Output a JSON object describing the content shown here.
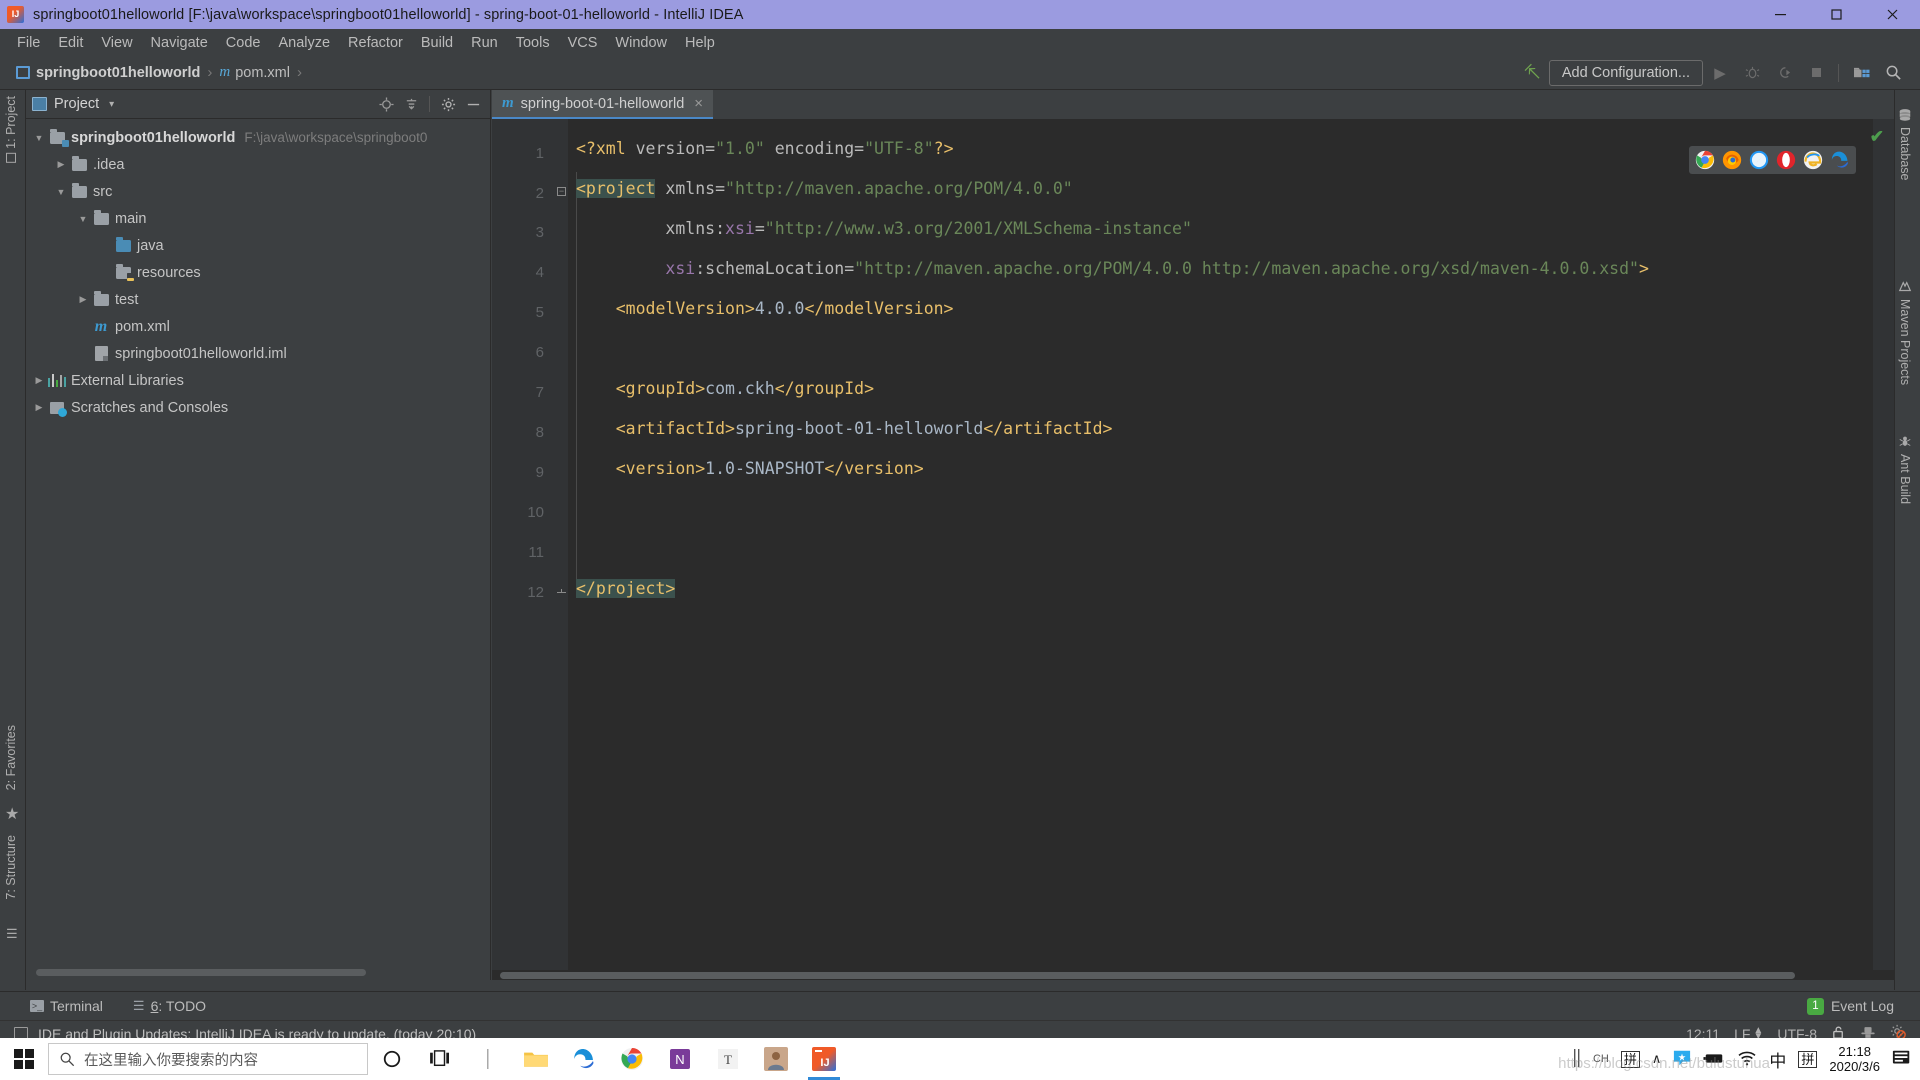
{
  "window": {
    "title": "springboot01helloworld [F:\\java\\workspace\\springboot01helloworld] - spring-boot-01-helloworld - IntelliJ IDEA",
    "app_icon": "intellij-idea-icon",
    "minimize_label": "—",
    "maximize_label": "❐",
    "close_label": "✕",
    "titlebar_color": "#9b9be0"
  },
  "menubar": {
    "items": [
      {
        "label": "File"
      },
      {
        "label": "Edit"
      },
      {
        "label": "View"
      },
      {
        "label": "Navigate"
      },
      {
        "label": "Code"
      },
      {
        "label": "Analyze"
      },
      {
        "label": "Refactor"
      },
      {
        "label": "Build"
      },
      {
        "label": "Run"
      },
      {
        "label": "Tools"
      },
      {
        "label": "VCS"
      },
      {
        "label": "Window"
      },
      {
        "label": "Help"
      }
    ]
  },
  "navbar": {
    "breadcrumb": {
      "project": "springboot01helloworld",
      "separator": "›",
      "file_icon": "m",
      "file": "pom.xml"
    },
    "add_configuration": "Add Configuration...",
    "icons": [
      "run-icon",
      "debug-icon",
      "run-with-coverage-icon",
      "stop-icon",
      "project-structure-icon",
      "search-everywhere-icon"
    ]
  },
  "left_rail": {
    "top": "1: Project",
    "favorites": "2: Favorites",
    "structure": "7: Structure"
  },
  "right_rail": {
    "database": "Database",
    "maven": "Maven Projects",
    "ant": "Ant Build"
  },
  "project_panel": {
    "title": "Project",
    "caret": "▾",
    "actions": [
      "locate-icon",
      "collapse-all-icon",
      "settings-gear-icon",
      "hide-icon"
    ],
    "tree": [
      {
        "label": "springboot01helloworld",
        "path": "F:\\java\\workspace\\springboot0",
        "depth": 0,
        "twisty": "▼",
        "icon": "module-folder-icon",
        "bold": true
      },
      {
        "label": ".idea",
        "path": "",
        "depth": 1,
        "twisty": "▶",
        "icon": "folder-icon",
        "bold": false
      },
      {
        "label": "src",
        "path": "",
        "depth": 1,
        "twisty": "▼",
        "icon": "folder-icon",
        "bold": false
      },
      {
        "label": "main",
        "path": "",
        "depth": 2,
        "twisty": "▼",
        "icon": "folder-icon",
        "bold": false
      },
      {
        "label": "java",
        "path": "",
        "depth": 3,
        "twisty": "",
        "icon": "source-folder-icon",
        "bold": false
      },
      {
        "label": "resources",
        "path": "",
        "depth": 3,
        "twisty": "",
        "icon": "resources-folder-icon",
        "bold": false
      },
      {
        "label": "test",
        "path": "",
        "depth": 2,
        "twisty": "▶",
        "icon": "folder-icon",
        "bold": false
      },
      {
        "label": "pom.xml",
        "path": "",
        "depth": 2,
        "twisty": "",
        "icon": "maven-file-icon",
        "bold": false
      },
      {
        "label": "springboot01helloworld.iml",
        "path": "",
        "depth": 2,
        "twisty": "",
        "icon": "iml-file-icon",
        "bold": false
      },
      {
        "label": "External Libraries",
        "path": "",
        "depth": 0,
        "twisty": "▶",
        "icon": "libraries-icon",
        "bold": false
      },
      {
        "label": "Scratches and Consoles",
        "path": "",
        "depth": 0,
        "twisty": "▶",
        "icon": "scratches-icon",
        "bold": false
      }
    ]
  },
  "editor": {
    "tab": {
      "label": "spring-boot-01-helloworld",
      "icon": "m",
      "close": "×"
    },
    "inspection_status": "✔",
    "browsers": [
      {
        "name": "chrome-icon",
        "color": "#4285f4"
      },
      {
        "name": "firefox-icon",
        "color": "#e66000"
      },
      {
        "name": "safari-icon",
        "color": "#2196f3"
      },
      {
        "name": "opera-icon",
        "color": "#e0252b"
      },
      {
        "name": "internet-explorer-icon",
        "color": "#f0b323"
      },
      {
        "name": "edge-icon",
        "color": "#1a8fd8"
      }
    ],
    "line_numbers": [
      1,
      2,
      3,
      4,
      5,
      6,
      7,
      8,
      9,
      10,
      11,
      12
    ],
    "code_lines": [
      {
        "n": 1,
        "segments": [
          {
            "t": "<?xml ",
            "c": "tag"
          },
          {
            "t": "version=",
            "c": "attr"
          },
          {
            "t": "\"1.0\"",
            "c": "str"
          },
          {
            "t": " encoding=",
            "c": "attr"
          },
          {
            "t": "\"UTF-8\"",
            "c": "str"
          },
          {
            "t": "?>",
            "c": "tag"
          }
        ]
      },
      {
        "n": 2,
        "segments": [
          {
            "t": "<project",
            "c": "tag hl"
          },
          {
            "t": " xmlns=",
            "c": "attr"
          },
          {
            "t": "\"http://maven.apache.org/POM/4.0.0\"",
            "c": "str"
          }
        ]
      },
      {
        "n": 3,
        "segments": [
          {
            "t": "         xmlns:",
            "c": "attr"
          },
          {
            "t": "xsi",
            "c": "ns"
          },
          {
            "t": "=",
            "c": "attr"
          },
          {
            "t": "\"http://www.w3.org/2001/XMLSchema-instance\"",
            "c": "str"
          }
        ]
      },
      {
        "n": 4,
        "segments": [
          {
            "t": "         ",
            "c": "attr"
          },
          {
            "t": "xsi",
            "c": "ns"
          },
          {
            "t": ":schemaLocation=",
            "c": "attr"
          },
          {
            "t": "\"http://maven.apache.org/POM/4.0.0 http://maven.apache.org/xsd/maven-4.0.0.xsd\"",
            "c": "str"
          },
          {
            "t": ">",
            "c": "tag"
          }
        ]
      },
      {
        "n": 5,
        "segments": [
          {
            "t": "    <modelVersion>",
            "c": "tag"
          },
          {
            "t": "4.0.0",
            "c": "txt"
          },
          {
            "t": "</modelVersion>",
            "c": "tag"
          }
        ]
      },
      {
        "n": 6,
        "segments": []
      },
      {
        "n": 7,
        "segments": [
          {
            "t": "    <groupId>",
            "c": "tag"
          },
          {
            "t": "com.ckh",
            "c": "txt"
          },
          {
            "t": "</groupId>",
            "c": "tag"
          }
        ]
      },
      {
        "n": 8,
        "segments": [
          {
            "t": "    <artifactId>",
            "c": "tag"
          },
          {
            "t": "spring-boot-01-helloworld",
            "c": "txt"
          },
          {
            "t": "</artifactId>",
            "c": "tag"
          }
        ]
      },
      {
        "n": 9,
        "segments": [
          {
            "t": "    <version>",
            "c": "tag"
          },
          {
            "t": "1.0-SNAPSHOT",
            "c": "txt"
          },
          {
            "t": "</version>",
            "c": "tag"
          }
        ]
      },
      {
        "n": 10,
        "segments": []
      },
      {
        "n": 11,
        "segments": []
      },
      {
        "n": 12,
        "segments": [
          {
            "t": "</project>",
            "c": "tag hl"
          }
        ]
      }
    ]
  },
  "bottom_tools": {
    "terminal": "Terminal",
    "todo_key": "6",
    "todo": ": TODO",
    "event_log": "Event Log",
    "event_log_count": "1"
  },
  "statusbar": {
    "message": "IDE and Plugin Updates: IntelliJ IDEA is ready to update. (today 20:10)",
    "caret_position": "12:11",
    "line_separator": "LF",
    "encoding": "UTF-8",
    "icons": [
      "lock-open-icon",
      "hat-icon",
      "gear-disabled-icon"
    ]
  },
  "taskbar": {
    "start": "windows-start-icon",
    "search_placeholder": "在这里输入你要搜索的内容",
    "cortana": "cortana-icon",
    "task_view": "task-view-icon",
    "apps": [
      {
        "name": "file-explorer-icon"
      },
      {
        "name": "edge-icon"
      },
      {
        "name": "chrome-icon"
      },
      {
        "name": "onenote-icon"
      },
      {
        "name": "typora-icon"
      },
      {
        "name": "user-avatar-icon"
      },
      {
        "name": "intellij-idea-icon"
      }
    ],
    "tray": {
      "ch": "CH",
      "pinyin": "拼",
      "chevron": "∧",
      "star_chat": "star-chat-icon",
      "battery": "battery-icon",
      "wifi": "wifi-icon",
      "chinese_mode": "中",
      "pinyin2": "拼",
      "time": "21:18",
      "date": "2020/3/6",
      "notifications": "action-center-icon"
    }
  },
  "watermark": "https://blog.csdn.net/bulustuhua"
}
